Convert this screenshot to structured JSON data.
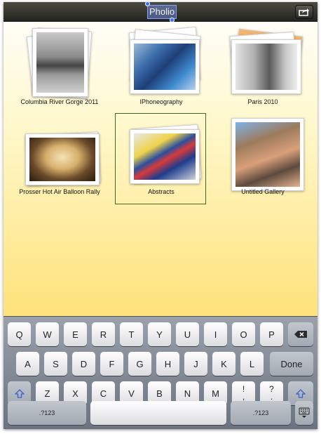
{
  "topbar": {
    "title": "Pholio",
    "share_icon": "share-arrow-icon"
  },
  "galleries": [
    {
      "name": "Columbia River Gorge 2011"
    },
    {
      "name": "IPhoneography"
    },
    {
      "name": "Paris 2010"
    },
    {
      "name": "Prosser Hot Air Balloon Rally"
    },
    {
      "name": "Abstracts",
      "selected": true
    },
    {
      "name": "Untitled Gallery"
    }
  ],
  "keyboard": {
    "row1": [
      "Q",
      "W",
      "E",
      "R",
      "T",
      "Y",
      "U",
      "I",
      "O",
      "P"
    ],
    "row2": [
      "A",
      "S",
      "D",
      "F",
      "G",
      "H",
      "J",
      "K",
      "L"
    ],
    "row3": [
      "Z",
      "X",
      "C",
      "V",
      "B",
      "N",
      "M"
    ],
    "done": "Done",
    "exclaim_top": "!",
    "exclaim_bottom": ",",
    "question_top": "?",
    "question_bottom": ".",
    "numbers_left": ".?123",
    "numbers_right": ".?123",
    "icons": {
      "backspace": "backspace-icon",
      "shift": "shift-icon",
      "hide": "keyboard-hide-icon"
    }
  }
}
